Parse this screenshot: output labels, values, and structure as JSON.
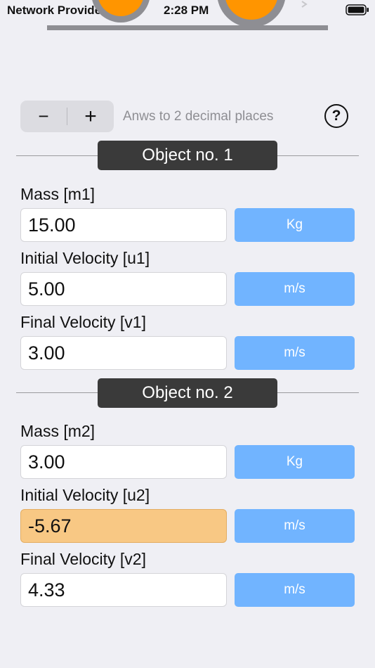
{
  "status_bar": {
    "carrier": "Network Provider",
    "time": "2:28 PM"
  },
  "toolbar": {
    "decrement_label": "−",
    "increment_label": "+",
    "hint": "Anws to 2 decimal places",
    "help_label": "?"
  },
  "object1": {
    "title": "Object no. 1",
    "fields": [
      {
        "label": "Mass [m1]",
        "value": "15.00",
        "unit": "Kg"
      },
      {
        "label": "Initial Velocity [u1]",
        "value": "5.00",
        "unit": "m/s"
      },
      {
        "label": "Final Velocity [v1]",
        "value": "3.00",
        "unit": "m/s"
      }
    ]
  },
  "object2": {
    "title": "Object no. 2",
    "fields": [
      {
        "label": "Mass [m2]",
        "value": "3.00",
        "unit": "Kg"
      },
      {
        "label": "Initial Velocity [u2]",
        "value": "-5.67",
        "unit": "m/s",
        "highlighted": true
      },
      {
        "label": "Final Velocity [v2]",
        "value": "4.33",
        "unit": "m/s"
      }
    ]
  },
  "colors": {
    "accent": "#71b4ff",
    "highlight": "#f8c884",
    "header": "#3a3a3a",
    "ball": "#ff9500"
  }
}
